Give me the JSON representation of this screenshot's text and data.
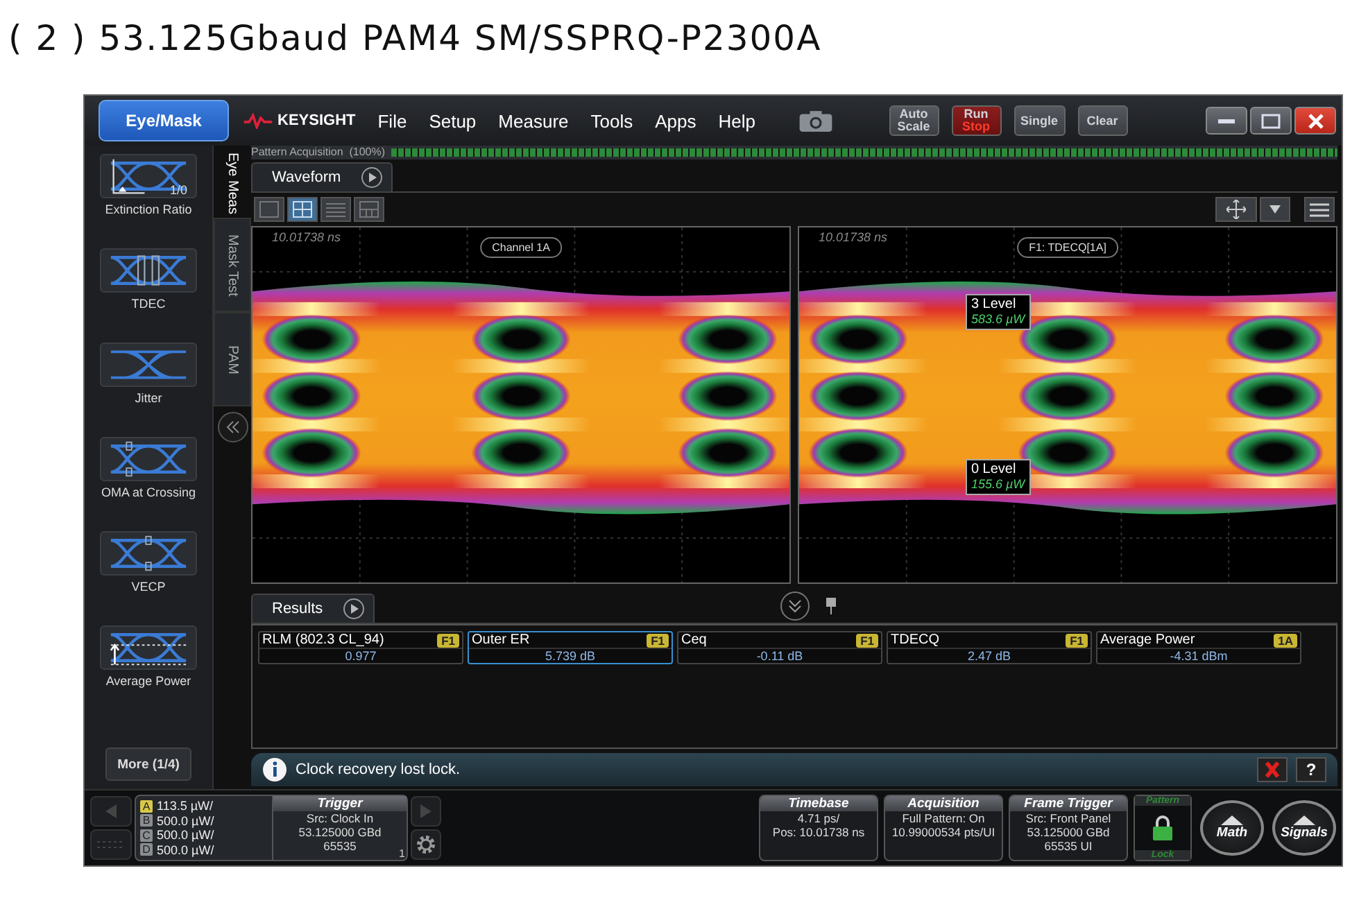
{
  "title": "( 2 ) 53.125Gbaud PAM4 SM/SSPRQ-P2300A",
  "app": {
    "mode_button": "Eye/Mask",
    "brand": "KEYSIGHT",
    "menus": [
      "File",
      "Setup",
      "Measure",
      "Tools",
      "Apps",
      "Help"
    ],
    "toolbar_buttons": [
      {
        "label": "Auto",
        "sublabel": "Scale",
        "kind": "plain"
      },
      {
        "label": "Run",
        "sublabel": "Stop",
        "kind": "run"
      },
      {
        "label": "Single",
        "kind": "plain"
      },
      {
        "label": "Clear",
        "kind": "plain"
      }
    ],
    "acquisition": {
      "status": "Pattern Acquisition  (100%)",
      "level": 1
    },
    "measurements": [
      {
        "label": "Extinction Ratio",
        "icon_text": "1/0",
        "kind": "extinction"
      },
      {
        "label": "TDEC",
        "kind": "tdec"
      },
      {
        "label": "Jitter",
        "kind": "jitter"
      },
      {
        "label": "OMA at Crossing",
        "kind": "oma"
      },
      {
        "label": "VECP",
        "kind": "vecp"
      },
      {
        "label": "Average Power",
        "kind": "power"
      }
    ],
    "more_button": "More (1/4)",
    "side_tabs": [
      {
        "label": "Eye Meas",
        "selected": true
      },
      {
        "label": "Mask Test",
        "selected": false
      },
      {
        "label": "PAM",
        "selected": false
      }
    ],
    "waveform_tab": "Waveform",
    "layouts": [
      {
        "kind": "single",
        "selected": false
      },
      {
        "kind": "quad",
        "selected": true
      },
      {
        "kind": "stacked",
        "selected": false
      },
      {
        "kind": "tiled",
        "selected": false
      }
    ],
    "plots": [
      {
        "time": "10.01738 ns",
        "source": "Channel 1A"
      },
      {
        "time": "10.01738 ns",
        "source": "F1: TDECQ[1A]",
        "markers": [
          {
            "name": "3 Level",
            "value": "583.6 µW"
          },
          {
            "name": "0 Level",
            "value": "155.6 µW"
          }
        ]
      }
    ],
    "results_tab": "Results",
    "results": [
      {
        "name": "RLM (802.3 CL_94)",
        "source": "F1",
        "value": "0.977",
        "selected": false
      },
      {
        "name": "Outer ER",
        "source": "F1",
        "value": "5.739 dB",
        "selected": true
      },
      {
        "name": "Ceq",
        "source": "F1",
        "value": "-0.11 dB",
        "selected": false
      },
      {
        "name": "TDECQ",
        "source": "F1",
        "value": "2.47 dB",
        "selected": false
      },
      {
        "name": "Average Power",
        "source": "1A",
        "value": "-4.31 dBm",
        "selected": false
      }
    ],
    "message": "Clock recovery lost lock.",
    "help_button": "?",
    "channels": [
      {
        "letter": "A",
        "scale": "113.5 µW/",
        "on": true
      },
      {
        "letter": "B",
        "scale": "500.0 µW/",
        "on": false
      },
      {
        "letter": "C",
        "scale": "500.0 µW/",
        "on": false
      },
      {
        "letter": "D",
        "scale": "500.0 µW/",
        "on": false
      }
    ],
    "trigger": {
      "title": "Trigger",
      "lines": [
        "Src: Clock In",
        "53.125000 GBd",
        "65535"
      ],
      "badge": "1"
    },
    "status_panels": [
      {
        "title": "Timebase",
        "lines": [
          "4.71 ps/",
          "Pos: 10.01738 ns"
        ]
      },
      {
        "title": "Acquisition",
        "lines": [
          "Full Pattern: On",
          "10.99000534 pts/UI"
        ]
      },
      {
        "title": "Frame Trigger",
        "lines": [
          "Src: Front Panel",
          "53.125000 GBd",
          "65535 UI"
        ]
      }
    ],
    "lock": {
      "top": "Pattern",
      "bottom": "Lock",
      "locked": true
    },
    "round_buttons": [
      "Math",
      "Signals"
    ]
  }
}
